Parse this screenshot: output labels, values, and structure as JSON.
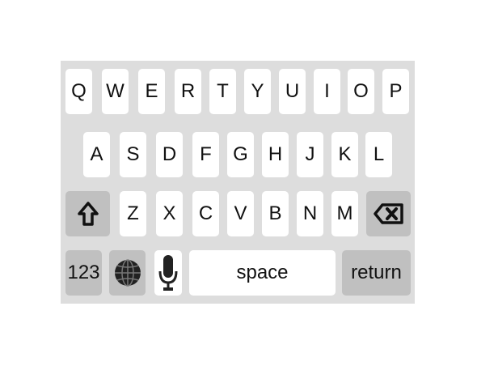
{
  "colors": {
    "keyboard_bg": "#dddddd",
    "key_bg": "#ffffff",
    "modifier_bg": "#c0c0c0",
    "key_text": "#111111"
  },
  "row1": [
    "Q",
    "W",
    "E",
    "R",
    "T",
    "Y",
    "U",
    "I",
    "O",
    "P"
  ],
  "row2": [
    "A",
    "S",
    "D",
    "F",
    "G",
    "H",
    "J",
    "K",
    "L"
  ],
  "row3": [
    "Z",
    "X",
    "C",
    "V",
    "B",
    "N",
    "M"
  ],
  "bottom": {
    "numbers_label": "123",
    "space_label": "space",
    "return_label": "return"
  },
  "icons": {
    "shift": "shift-arrow-icon",
    "backspace": "backspace-icon",
    "globe": "globe-icon",
    "mic": "microphone-icon"
  }
}
